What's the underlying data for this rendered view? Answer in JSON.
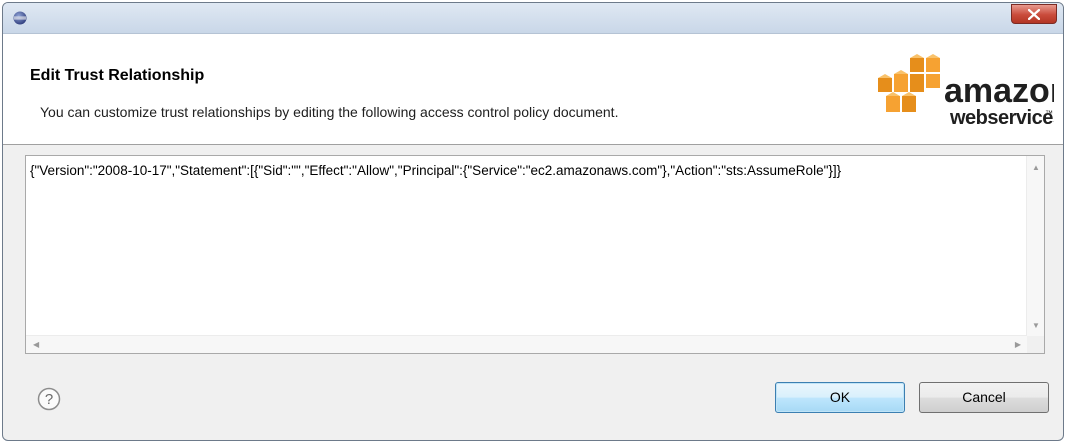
{
  "dialog": {
    "title": "Edit Trust Relationship",
    "description": "You can customize trust relationships by editing the following access control policy document."
  },
  "logo": {
    "line1": "amazon",
    "line2": "webservices",
    "trademark": "™",
    "colors": {
      "cube": "#f29b24",
      "text": "#1f1f1f"
    }
  },
  "editor": {
    "content": "{\"Version\":\"2008-10-17\",\"Statement\":[{\"Sid\":\"\",\"Effect\":\"Allow\",\"Principal\":{\"Service\":\"ec2.amazonaws.com\"},\"Action\":\"sts:AssumeRole\"}]}"
  },
  "buttons": {
    "ok_label": "OK",
    "cancel_label": "Cancel",
    "help_icon": "question-mark-circle-icon"
  },
  "window": {
    "icon": "eclipse-icon",
    "close_icon": "close-icon"
  }
}
